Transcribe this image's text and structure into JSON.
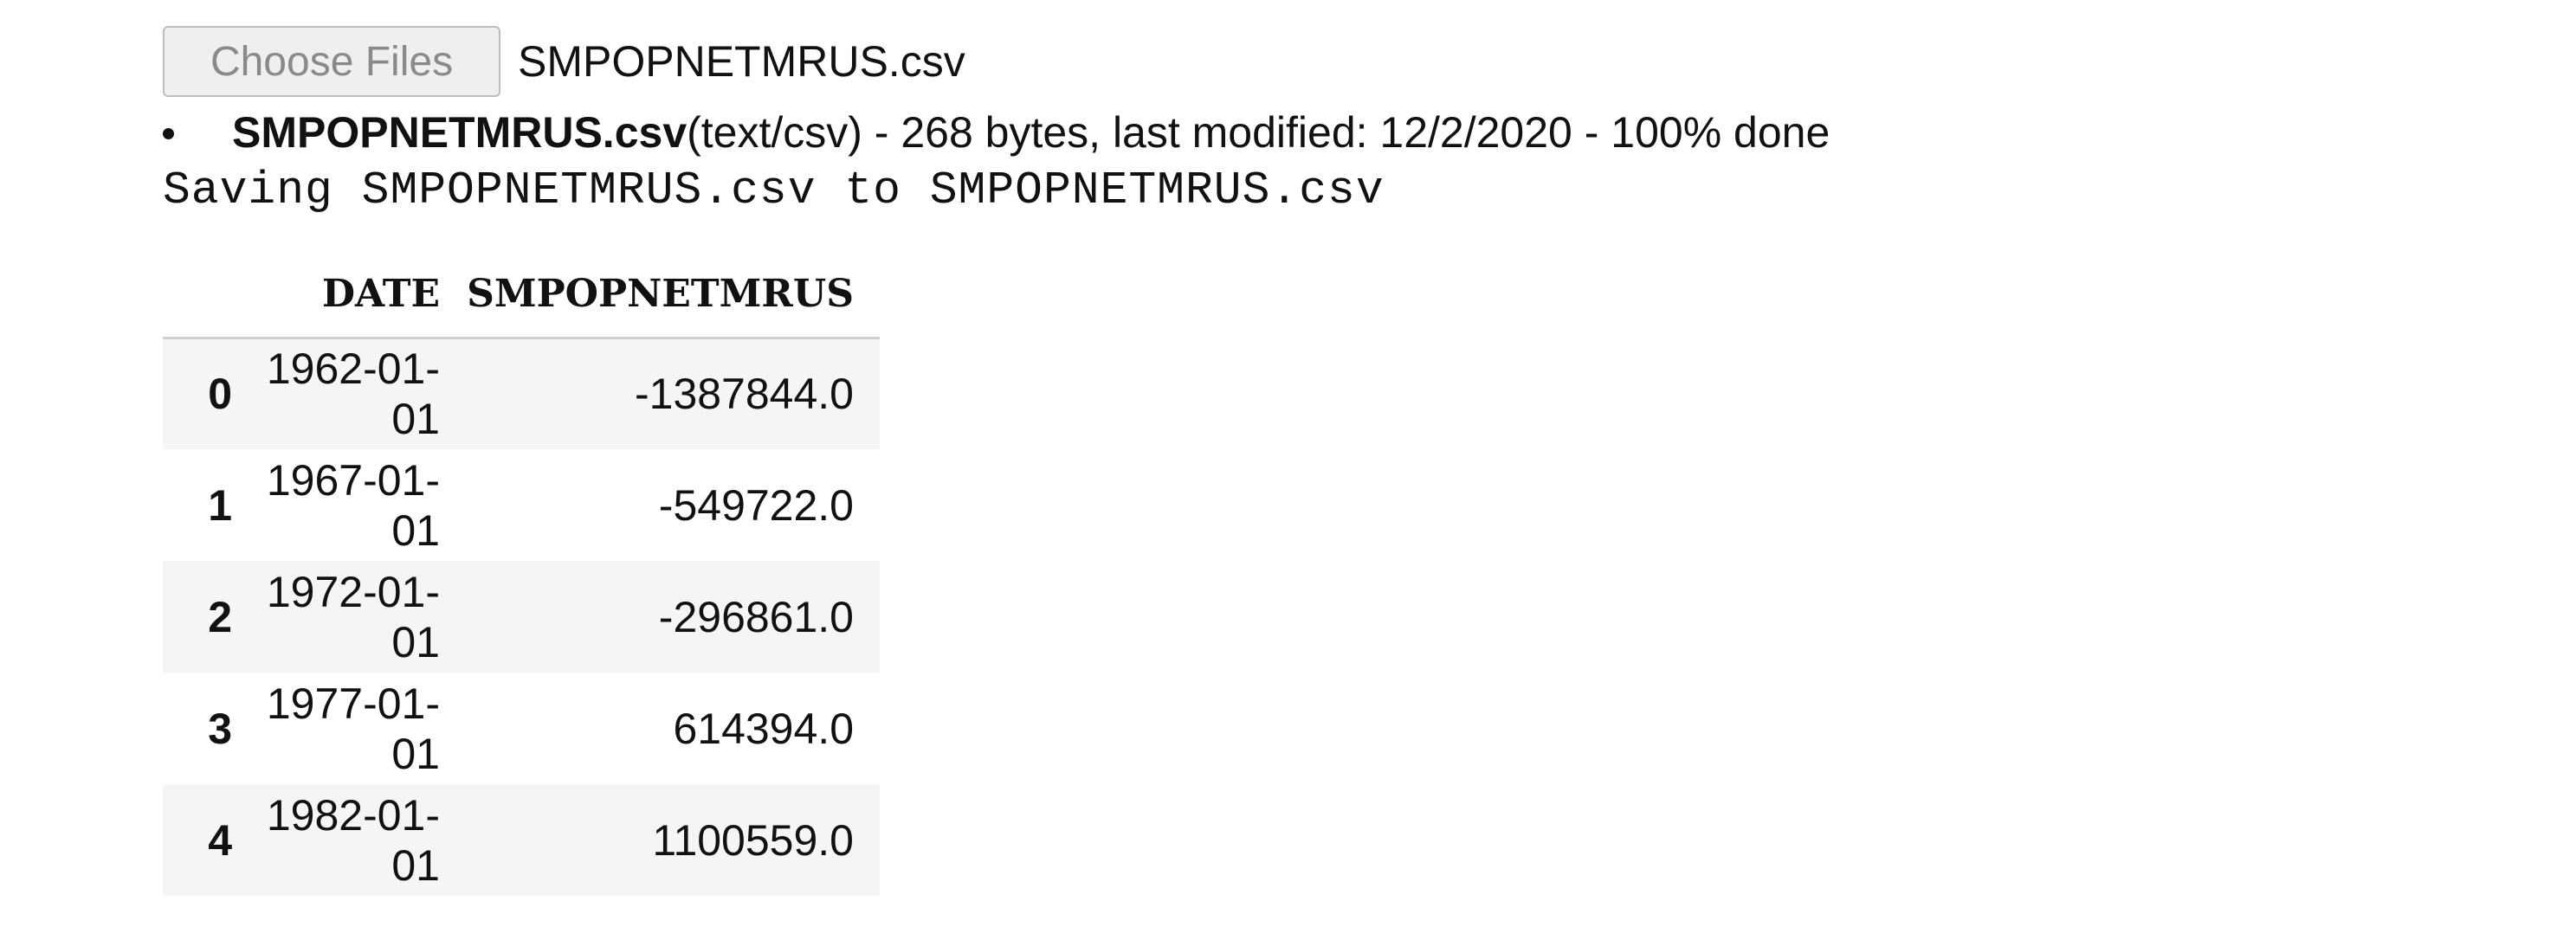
{
  "upload": {
    "button_label": "Choose Files",
    "selected_file": "SMPOPNETMRUS.csv"
  },
  "file_list": [
    {
      "name": "SMPOPNETMRUS.csv",
      "details": "(text/csv) - 268 bytes, last modified: 12/2/2020 - 100% done"
    }
  ],
  "output_text": "Saving SMPOPNETMRUS.csv to SMPOPNETMRUS.csv",
  "table": {
    "columns": [
      "",
      "DATE",
      "SMPOPNETMRUS"
    ],
    "rows": [
      {
        "index": "0",
        "date": "1962-01-01",
        "value": "-1387844.0"
      },
      {
        "index": "1",
        "date": "1967-01-01",
        "value": "-549722.0"
      },
      {
        "index": "2",
        "date": "1972-01-01",
        "value": "-296861.0"
      },
      {
        "index": "3",
        "date": "1977-01-01",
        "value": "614394.0"
      },
      {
        "index": "4",
        "date": "1982-01-01",
        "value": "1100559.0"
      }
    ]
  }
}
